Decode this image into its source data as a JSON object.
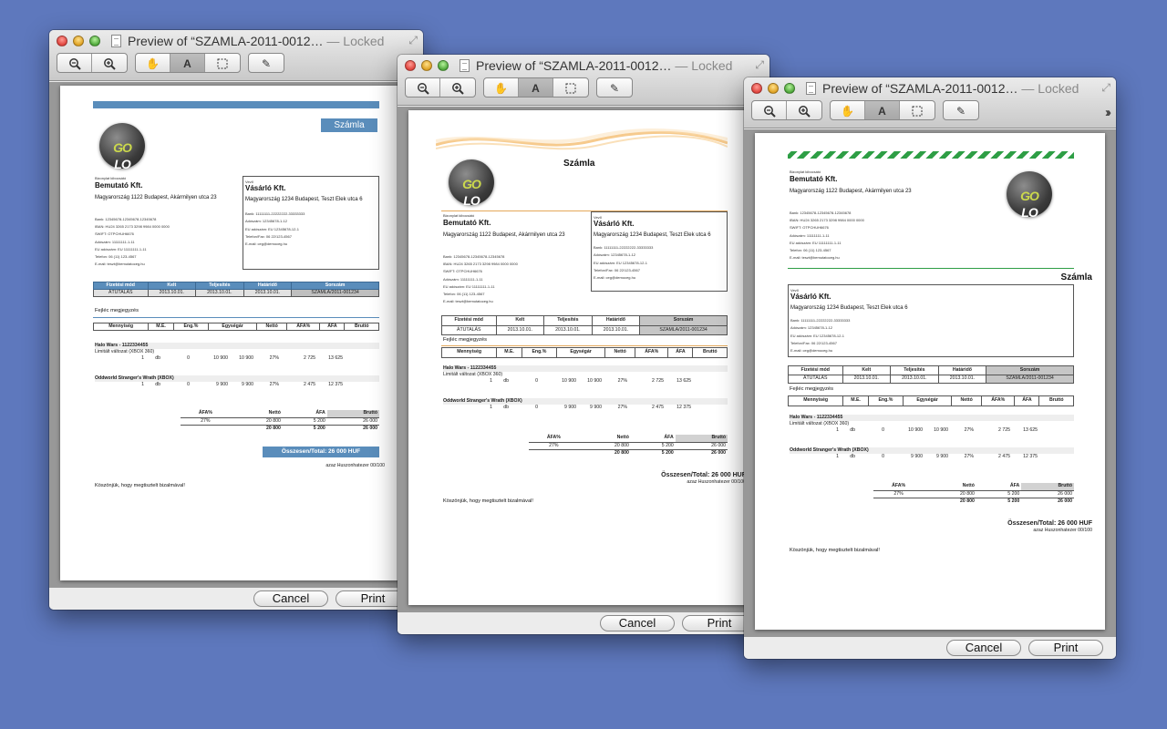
{
  "common": {
    "title_prefix": "Preview of “SZAMLA-2011-0012…",
    "title_suffix": " — Locked",
    "cancel_label": "Cancel",
    "print_label": "Print",
    "logo_lo": "LO",
    "logo_go": "GO"
  },
  "invoice": {
    "title": "Számla",
    "issuer_caption": "Bizonylat kiboc­sátó",
    "issuer_name": "Bemutató Kft.",
    "issuer_address": "Magyarország 1122 Budapest, Akármilyen utca 23",
    "issuer_bank": "Bank: 12345678-12345678-12345678",
    "issuer_iban": "IBAN: HU24 3265 2173 3298 9984 0000 0000",
    "issuer_swift": "SWIFT: OTPCHUH6676",
    "issuer_tax": "Adószám: 11111111-1-11",
    "issuer_eutax": "EU adószám: EU 11111111-1-11",
    "issuer_phone": "Telefon: 06 (11) 123-4567",
    "issuer_email": "E-mail: teszt@bemutatoceg.hu",
    "buyer_caption": "Vevő",
    "buyer_name": "Vásárló Kft.",
    "buyer_address": "Magyarország 1234 Budapest, Teszt Elek utca 6",
    "buyer_bank": "Bank: 11111111-22222222-33333333",
    "buyer_tax": "Adószám: 12345678-1-12",
    "buyer_eutax": "EU adószám: EU 12345678-12-1",
    "buyer_phone": "Telefon/Fax: 06 22/123-4567",
    "buyer_email": "E-mail: ceg@democeg.hu",
    "payment_headers": [
      "Fizetési mód",
      "Kelt",
      "Teljesítés",
      "Határidő",
      "Sorszám"
    ],
    "payment_values": [
      "ÁTUTALÁS",
      "2013.10.01.",
      "2013.10.01.",
      "2013.10.01.",
      "SZAMLA/2011-001234"
    ],
    "header_note": "Fejléc megjegyzés",
    "item_headers": [
      "Mennyiség",
      "M.E.",
      "Eng.%",
      "Egységár",
      "Nettó",
      "ÁFA%",
      "ÁFA",
      "Bruttó"
    ],
    "items": [
      {
        "name": "Halo Wars - 1122334455",
        "sub": "Limitált változat (XBOX 360)",
        "qty": "1",
        "unit": "db",
        "disc": "0",
        "price": "10 900",
        "net": "10 900",
        "vatp": "27%",
        "vat": "2 725",
        "gross": "13 625"
      },
      {
        "name": "Oddworld Stranger's Wrath (XBOX)",
        "sub": "",
        "qty": "1",
        "unit": "db",
        "disc": "0",
        "price": "9 900",
        "net": "9 900",
        "vatp": "27%",
        "vat": "2 475",
        "gross": "12 375"
      }
    ],
    "sum_headers": [
      "ÁFA%",
      "Nettó",
      "ÁFA",
      "Bruttó"
    ],
    "sum_row": [
      "27%",
      "20 800",
      "5 200",
      "26 000"
    ],
    "sum_total": [
      "",
      "20 800",
      "5 200",
      "26 000"
    ],
    "total": "Összesen/Total: 26 000 HUF",
    "in_words": "azaz Huszonhatezer 00/100",
    "thanks": "Köszönjük, hogy megtisztelt bizalmával!"
  }
}
